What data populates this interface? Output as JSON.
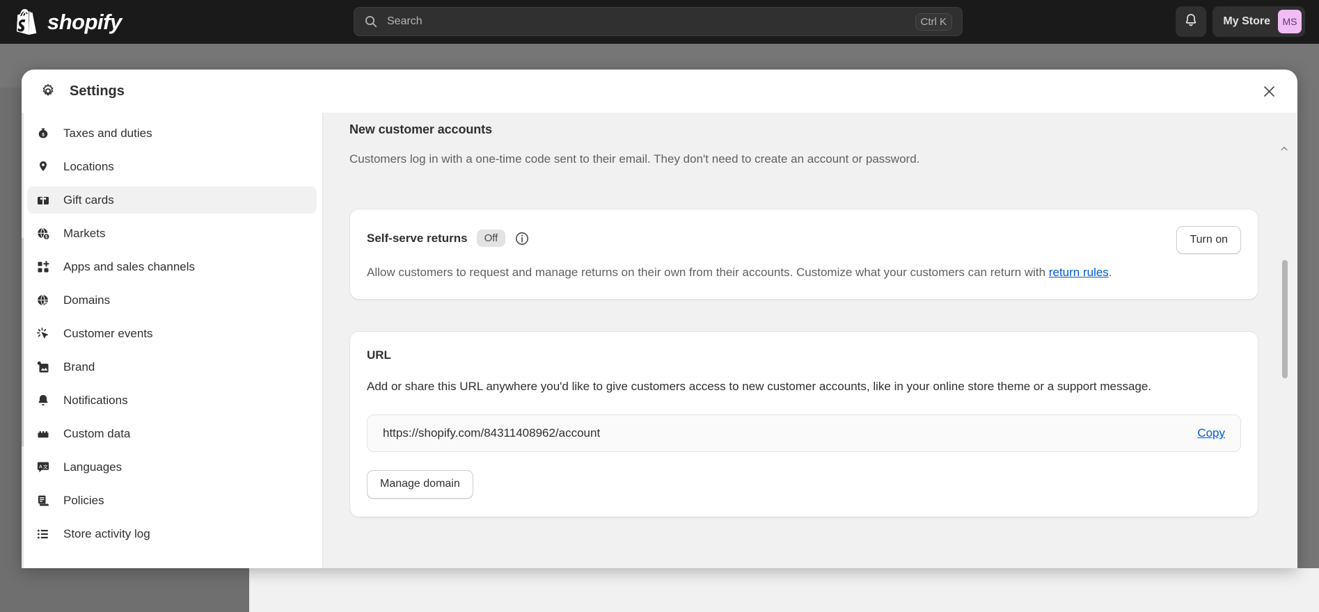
{
  "topbar": {
    "logo_word": "shopify",
    "logo_icon": "shopify-bag-icon",
    "search": {
      "placeholder": "Search",
      "shortcut": "Ctrl K",
      "icon": "search-icon"
    },
    "notifications_icon": "bell-icon",
    "store_name": "My Store",
    "avatar_initials": "MS",
    "avatar_color": "#f2bdf7",
    "background": "#1a1a1a"
  },
  "modal": {
    "title": "Settings",
    "title_icon": "gear-icon",
    "close_icon": "close-icon"
  },
  "sidebar": {
    "items": [
      {
        "label": "Taxes and duties",
        "icon": "money-bag-icon",
        "selected": false
      },
      {
        "label": "Locations",
        "icon": "location-pin-icon",
        "selected": false
      },
      {
        "label": "Gift cards",
        "icon": "gift-card-icon",
        "selected": true
      },
      {
        "label": "Markets",
        "icon": "globe-dollar-icon",
        "selected": false
      },
      {
        "label": "Apps and sales channels",
        "icon": "apps-plus-icon",
        "selected": false
      },
      {
        "label": "Domains",
        "icon": "globe-cursor-icon",
        "selected": false
      },
      {
        "label": "Customer events",
        "icon": "click-burst-icon",
        "selected": false
      },
      {
        "label": "Brand",
        "icon": "image-icon",
        "selected": false
      },
      {
        "label": "Notifications",
        "icon": "bell-icon",
        "selected": false
      },
      {
        "label": "Custom data",
        "icon": "database-icon",
        "selected": false
      },
      {
        "label": "Languages",
        "icon": "translate-icon",
        "selected": false
      },
      {
        "label": "Policies",
        "icon": "policy-doc-icon",
        "selected": false
      },
      {
        "label": "Store activity log",
        "icon": "list-icon",
        "selected": false
      }
    ]
  },
  "content": {
    "section": {
      "title": "New customer accounts",
      "description": "Customers log in with a one-time code sent to their email. They don't need to create an account or password."
    },
    "returns_card": {
      "title": "Self-serve returns",
      "status_badge": "Off",
      "info_icon": "info-circle-icon",
      "action_label": "Turn on",
      "description_before_link": "Allow customers to request and manage returns on their own from their accounts. Customize what your customers can return with ",
      "link_text": "return rules",
      "description_after_link": "."
    },
    "url_card": {
      "title": "URL",
      "description": "Add or share this URL anywhere you'd like to give customers access to new customer accounts, like in your online store theme or a support message.",
      "url_value": "https://shopify.com/84311408962/account",
      "copy_label": "Copy",
      "manage_domain_label": "Manage domain",
      "link_color": "#005bd3"
    }
  }
}
